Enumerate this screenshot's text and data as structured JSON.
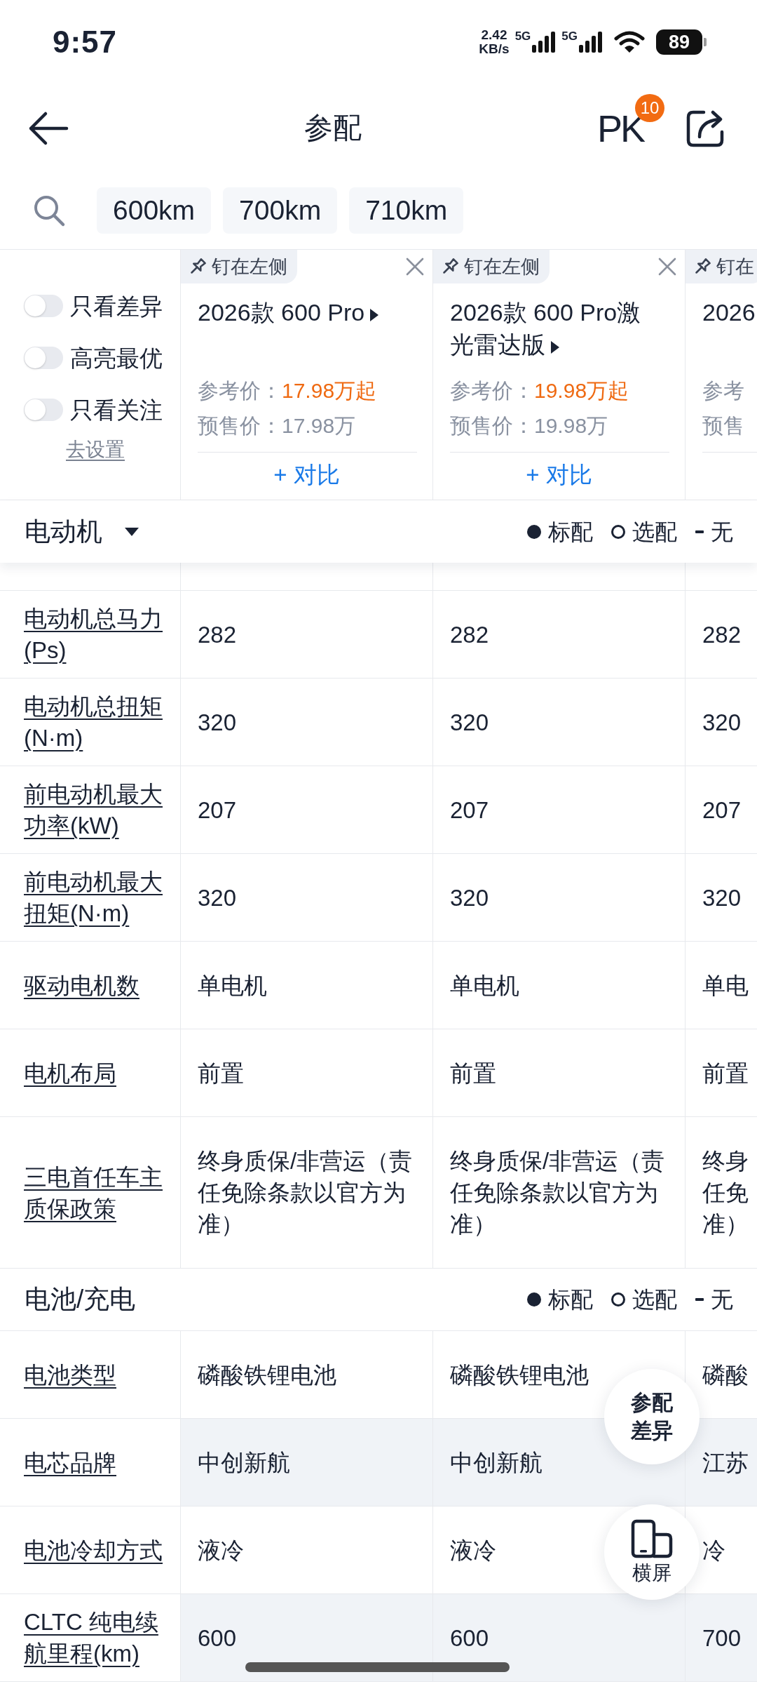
{
  "status_bar": {
    "time": "9:57",
    "network_speed": "2.42",
    "speed_unit": "KB/s",
    "networks": [
      {
        "type": "5G"
      },
      {
        "type": "5G"
      }
    ],
    "battery": "89"
  },
  "header": {
    "title": "参配",
    "pk_label": "PK",
    "pk_badge": "10"
  },
  "filter_chips": [
    {
      "label": "600km"
    },
    {
      "label": "700km"
    },
    {
      "label": "710km"
    }
  ],
  "options": {
    "toggles": [
      {
        "label": "只看差异",
        "on": false
      },
      {
        "label": "高亮最优",
        "on": false
      },
      {
        "label": "只看关注",
        "on": false
      }
    ],
    "settings_link": "去设置"
  },
  "cars": [
    {
      "pin_label": "钉在左侧",
      "closable": true,
      "name": "2026款 600 Pro",
      "expandable": true,
      "ref_price_label": "参考价：",
      "ref_price": "17.98万起",
      "presale_label": "预售价：",
      "presale_price": "17.98万",
      "compare_label": "+ 对比"
    },
    {
      "pin_label": "钉在左侧",
      "closable": true,
      "name": "2026款 600 Pro激光雷达版",
      "expandable": true,
      "ref_price_label": "参考价：",
      "ref_price": "19.98万起",
      "presale_label": "预售价：",
      "presale_price": "19.98万",
      "compare_label": "+ 对比"
    },
    {
      "pin_label": "钉在",
      "name": "2026",
      "ref_price_label": "参考",
      "presale_label": "预售"
    }
  ],
  "sections": [
    {
      "title": "电动机",
      "collapsible": true,
      "sticky": true,
      "legend": [
        {
          "kind": "standard",
          "label": "标配"
        },
        {
          "kind": "optional",
          "label": "选配"
        },
        {
          "kind": "none",
          "label": "无"
        }
      ],
      "rows": [
        {
          "label": "电动机总马力(Ps)",
          "values": [
            "282",
            "282",
            "282"
          ],
          "highlight": false
        },
        {
          "label": "电动机总扭矩(N·m)",
          "values": [
            "320",
            "320",
            "320"
          ],
          "highlight": false
        },
        {
          "label": "前电动机最大功率(kW)",
          "values": [
            "207",
            "207",
            "207"
          ],
          "highlight": false
        },
        {
          "label": "前电动机最大扭矩(N·m)",
          "values": [
            "320",
            "320",
            "320"
          ],
          "highlight": false
        },
        {
          "label": "驱动电机数",
          "values": [
            "单电机",
            "单电机",
            "单电"
          ],
          "highlight": false
        },
        {
          "label": "电机布局",
          "values": [
            "前置",
            "前置",
            "前置"
          ],
          "highlight": false
        },
        {
          "label": "三电首任车主质保政策",
          "values": [
            "终身质保/非营运（责任免除条款以官方为准）",
            "终身质保/非营运（责任免除条款以官方为准）",
            "终身任免准）"
          ],
          "highlight": false
        }
      ]
    },
    {
      "title": "电池/充电",
      "collapsible": false,
      "sticky": false,
      "legend": [
        {
          "kind": "standard",
          "label": "标配"
        },
        {
          "kind": "optional",
          "label": "选配"
        },
        {
          "kind": "none",
          "label": "无"
        }
      ],
      "rows": [
        {
          "label": "电池类型",
          "values": [
            "磷酸铁锂电池",
            "磷酸铁锂电池",
            "磷酸"
          ],
          "highlight": false
        },
        {
          "label": "电芯品牌",
          "values": [
            "中创新航",
            "中创新航",
            "江苏"
          ],
          "highlight": true
        },
        {
          "label": "电池冷却方式",
          "values": [
            "液冷",
            "液冷",
            "冷"
          ],
          "highlight": false
        },
        {
          "label": "CLTC 纯电续航里程(km)",
          "values": [
            "600",
            "600",
            "700"
          ],
          "highlight": true
        }
      ]
    }
  ],
  "floating_buttons": [
    {
      "kind": "diff",
      "label": "参配差异"
    },
    {
      "kind": "landscape",
      "label": "横屏"
    }
  ]
}
